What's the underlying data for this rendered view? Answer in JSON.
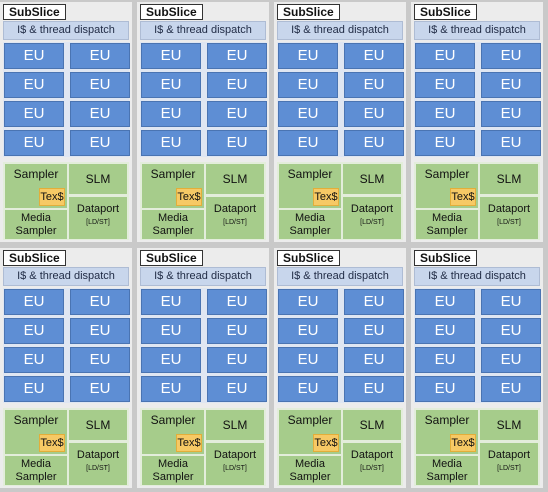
{
  "diagram": {
    "title_label": "SubSlice",
    "dispatch_label": "I$ & thread dispatch",
    "eu_label": "EU",
    "eu_count": 8,
    "sampler_label": "Sampler",
    "tex_label": "Tex$",
    "media_label": "Media Sampler",
    "slm_label": "SLM",
    "dataport_label": "Dataport",
    "dataport_sub": "[LD/ST]",
    "subslice_count": 8,
    "colors": {
      "eu": "#5e8ed4",
      "dispatch": "#c8d6ec",
      "texture_blocks": "#a6cc8b",
      "tex_cache": "#f6c965"
    }
  }
}
